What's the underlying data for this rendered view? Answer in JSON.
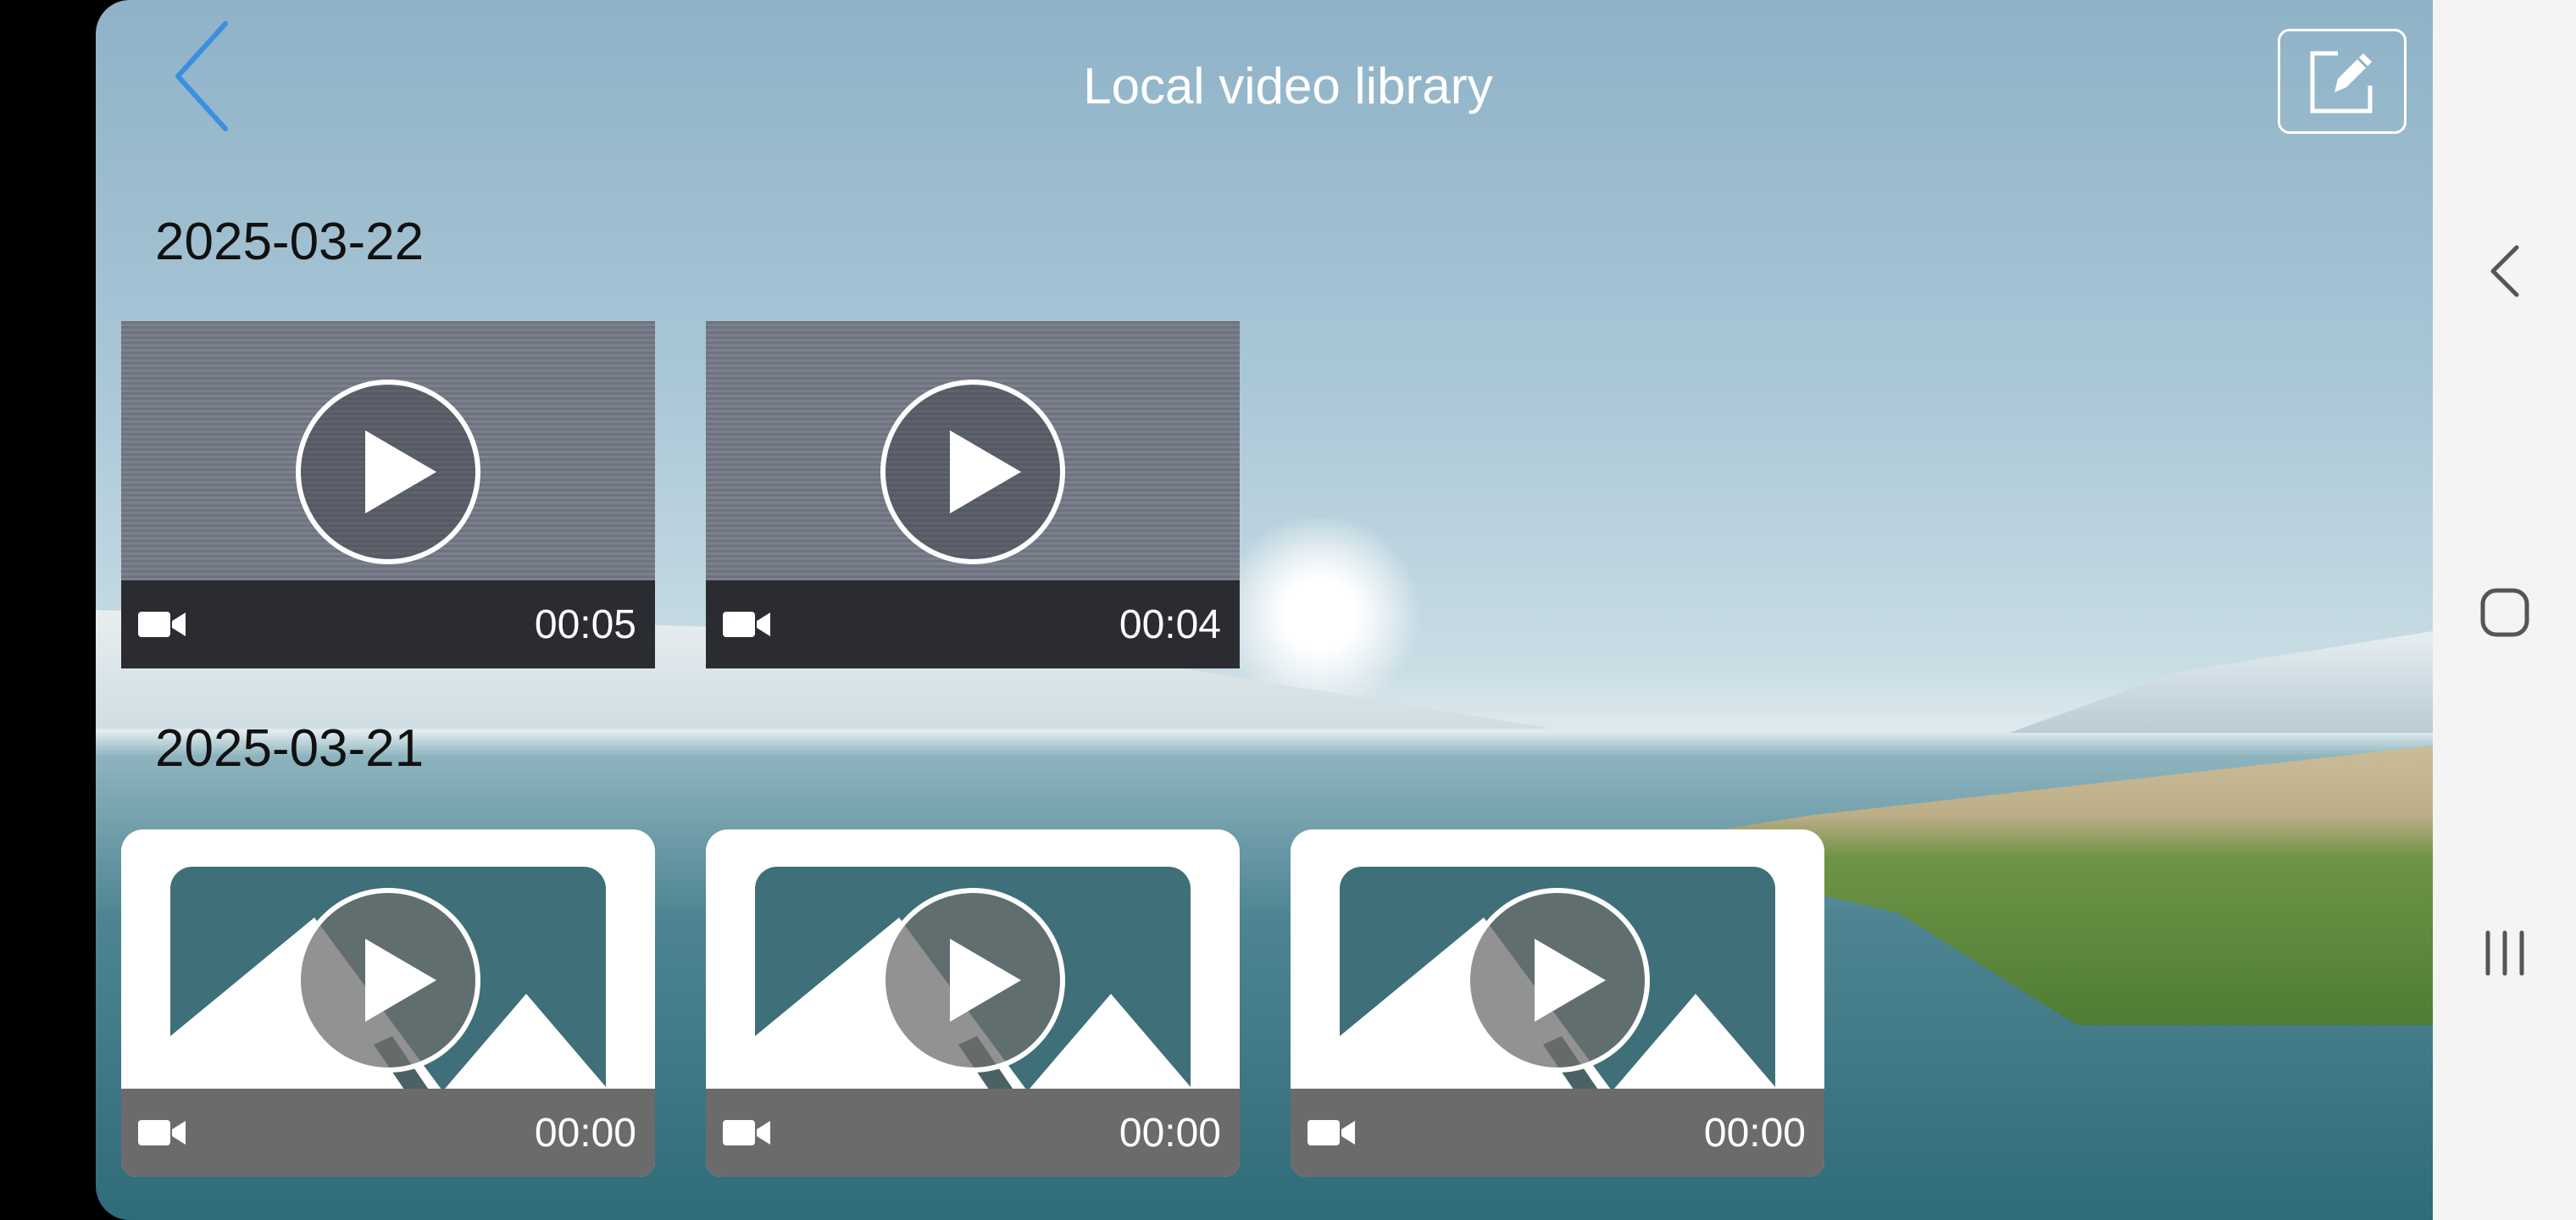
{
  "header": {
    "title": "Local video library",
    "back_icon": "chevron-left-icon",
    "edit_icon": "edit-icon"
  },
  "groups": [
    {
      "date": "2025-03-22",
      "videos": [
        {
          "duration": "00:05",
          "thumbnail": "recorded-frame"
        },
        {
          "duration": "00:04",
          "thumbnail": "recorded-frame"
        }
      ]
    },
    {
      "date": "2025-03-21",
      "videos": [
        {
          "duration": "00:00",
          "thumbnail": "image-placeholder"
        },
        {
          "duration": "00:00",
          "thumbnail": "image-placeholder"
        },
        {
          "duration": "00:00",
          "thumbnail": "image-placeholder"
        }
      ]
    }
  ],
  "system_nav": {
    "back": "nav-back-icon",
    "home": "nav-home-icon",
    "recents": "nav-recents-icon"
  },
  "colors": {
    "accent": "#3b8fe0",
    "bar_dark": "#2b2c31",
    "bar_gray": "#6b6b6b"
  }
}
